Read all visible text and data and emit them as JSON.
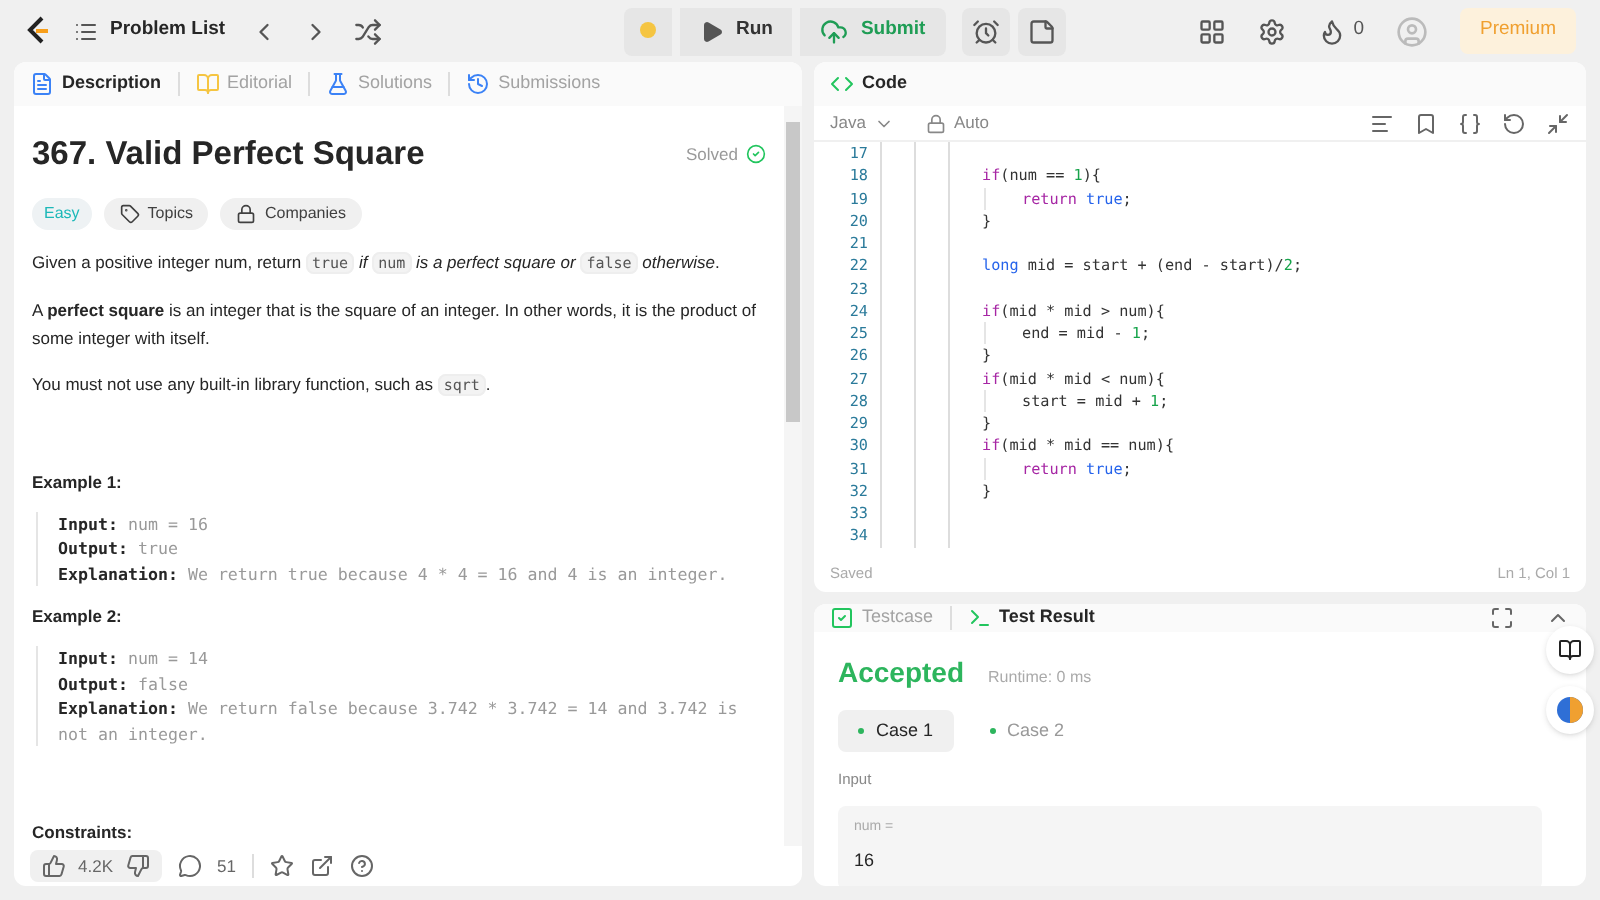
{
  "nav": {
    "problem_list": "Problem List",
    "run": "Run",
    "submit": "Submit",
    "streak": "0",
    "premium": "Premium"
  },
  "description": {
    "tabs": [
      {
        "label": "Description",
        "selected": true,
        "kind": "description"
      },
      {
        "label": "Editorial",
        "selected": false,
        "kind": "editorial"
      },
      {
        "label": "Solutions",
        "selected": false,
        "kind": "solutions"
      },
      {
        "label": "Submissions",
        "selected": false,
        "kind": "submissions"
      }
    ],
    "title": "367. Valid Perfect Square",
    "status": "Solved",
    "tags": [
      {
        "label": "Easy",
        "kind": "difficulty"
      },
      {
        "label": "Topics",
        "kind": "topics"
      },
      {
        "label": "Companies",
        "kind": "companies"
      }
    ],
    "paragraphs": [
      [
        {
          "kind": "text",
          "text": "Given a positive integer num, return "
        },
        {
          "kind": "code",
          "text": "true"
        },
        {
          "kind": "italic",
          "text": " if "
        },
        {
          "kind": "code",
          "text": "num"
        },
        {
          "kind": "italic",
          "text": " is a perfect square or "
        },
        {
          "kind": "code",
          "text": "false"
        },
        {
          "kind": "italic",
          "text": " otherwise"
        },
        {
          "kind": "text",
          "text": "."
        }
      ],
      [
        {
          "kind": "text",
          "text": "A **perfect square** is an integer that is the square of an integer. In other words, it is the product of some integer with itself."
        }
      ],
      [
        {
          "kind": "text",
          "text": "You must not use any built-in library function, such as "
        },
        {
          "kind": "code",
          "text": "sqrt"
        },
        {
          "kind": "text",
          "text": "."
        }
      ]
    ],
    "examples": [
      {
        "heading": "Example 1:",
        "lines": [
          {
            "label": "Input:",
            "value": "num = 16"
          },
          {
            "label": "Output:",
            "value": "true"
          },
          {
            "label": "Explanation:",
            "value": "We return true because 4 * 4 = 16 and 4 is an integer."
          }
        ]
      },
      {
        "heading": "Example 2:",
        "lines": [
          {
            "label": "Input:",
            "value": "num = 14"
          },
          {
            "label": "Output:",
            "value": "false"
          },
          {
            "label": "Explanation:",
            "value": "We return false because 3.742 * 3.742 = 14 and 3.742 is not an integer."
          }
        ]
      }
    ],
    "constraints_heading": "Constraints:",
    "likes": "4.2K",
    "comments": "51"
  },
  "code": {
    "title": "Code",
    "language": "Java",
    "mode": "Auto",
    "lines": [
      {
        "number": "17"
      },
      {
        "number": "18",
        "indented": false,
        "tokens": [
          {
            "kind": "kw",
            "text": "if"
          },
          {
            "kind": "plain",
            "text": "(num == "
          },
          {
            "kind": "num",
            "text": "1"
          },
          {
            "kind": "plain",
            "text": "){"
          }
        ]
      },
      {
        "number": "19",
        "indented": true,
        "tokens": [
          {
            "kind": "kw",
            "text": "return"
          },
          {
            "kind": "lit",
            "text": " true"
          },
          {
            "kind": "plain",
            "text": ";"
          }
        ]
      },
      {
        "number": "20",
        "indented": false,
        "tokens": [
          {
            "kind": "plain",
            "text": "}"
          }
        ]
      },
      {
        "number": "21"
      },
      {
        "number": "22",
        "indented": false,
        "tokens": [
          {
            "kind": "lit",
            "text": "long"
          },
          {
            "kind": "plain",
            "text": " mid = start + (end - start)/"
          },
          {
            "kind": "num",
            "text": "2"
          },
          {
            "kind": "plain",
            "text": ";"
          }
        ]
      },
      {
        "number": "23"
      },
      {
        "number": "24",
        "indented": false,
        "tokens": [
          {
            "kind": "kw",
            "text": "if"
          },
          {
            "kind": "plain",
            "text": "(mid * mid > num){"
          }
        ]
      },
      {
        "number": "25",
        "indented": true,
        "tokens": [
          {
            "kind": "plain",
            "text": "end = mid - "
          },
          {
            "kind": "num",
            "text": "1"
          },
          {
            "kind": "plain",
            "text": ";"
          }
        ]
      },
      {
        "number": "26",
        "indented": false,
        "tokens": [
          {
            "kind": "plain",
            "text": "}"
          }
        ]
      },
      {
        "number": "27",
        "indented": false,
        "tokens": [
          {
            "kind": "kw",
            "text": "if"
          },
          {
            "kind": "plain",
            "text": "(mid * mid < num){"
          }
        ]
      },
      {
        "number": "28",
        "indented": true,
        "tokens": [
          {
            "kind": "plain",
            "text": "start = mid + "
          },
          {
            "kind": "num",
            "text": "1"
          },
          {
            "kind": "plain",
            "text": ";"
          }
        ]
      },
      {
        "number": "29",
        "indented": false,
        "tokens": [
          {
            "kind": "plain",
            "text": "}"
          }
        ]
      },
      {
        "number": "30",
        "indented": false,
        "tokens": [
          {
            "kind": "kw",
            "text": "if"
          },
          {
            "kind": "plain",
            "text": "(mid * mid == num){"
          }
        ]
      },
      {
        "number": "31",
        "indented": true,
        "tokens": [
          {
            "kind": "kw",
            "text": "return"
          },
          {
            "kind": "lit",
            "text": " true"
          },
          {
            "kind": "plain",
            "text": ";"
          }
        ]
      },
      {
        "number": "32",
        "indented": false,
        "tokens": [
          {
            "kind": "plain",
            "text": "}"
          }
        ]
      },
      {
        "number": "33"
      },
      {
        "number": "34"
      }
    ],
    "saved": "Saved",
    "cursor": "Ln 1, Col 1"
  },
  "result": {
    "tabs": [
      {
        "label": "Testcase",
        "selected": false,
        "kind": "testcase"
      },
      {
        "label": "Test Result",
        "selected": true,
        "kind": "result"
      }
    ],
    "verdict": "Accepted",
    "runtime": "Runtime: 0 ms",
    "cases": [
      {
        "label": "Case 1",
        "selected": true
      },
      {
        "label": "Case 2",
        "selected": false
      }
    ],
    "input_label": "Input",
    "param": "num =",
    "value": "16"
  }
}
